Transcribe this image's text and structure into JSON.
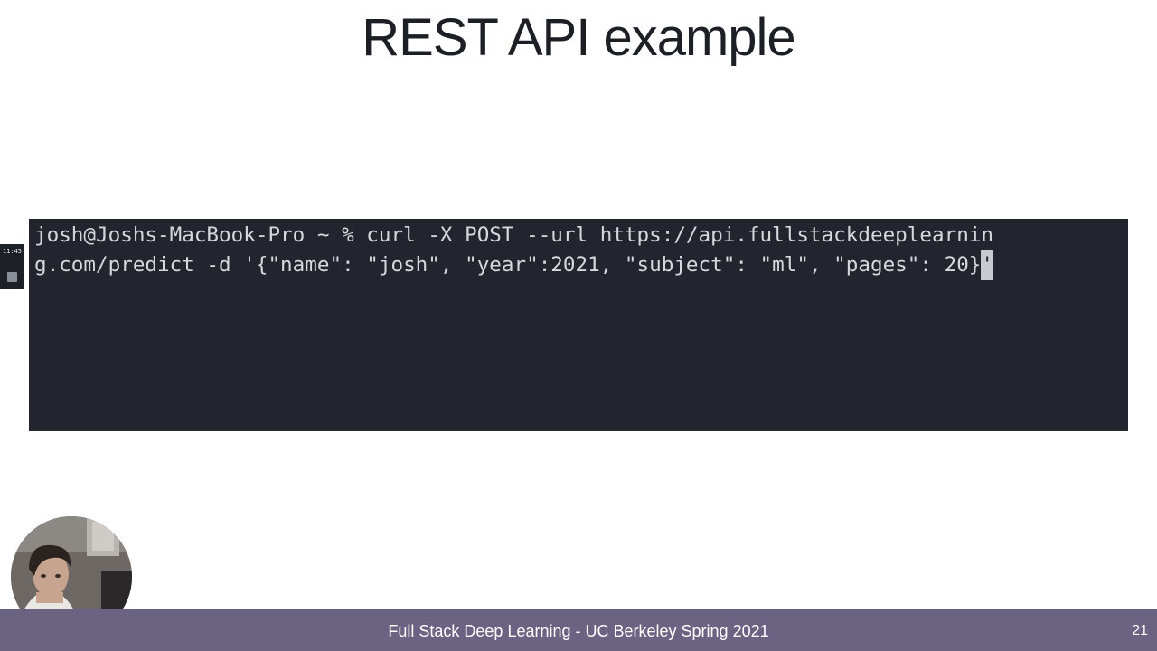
{
  "slide": {
    "title": "REST API example",
    "footer": "Full Stack Deep Learning - UC Berkeley Spring 2021",
    "page_number": "21"
  },
  "terminal": {
    "line1": "josh@Joshs-MacBook-Pro ~ % curl -X POST --url https://api.fullstackdeeplearnin",
    "line2": "g.com/predict -d '{\"name\": \"josh\", \"year\":2021, \"subject\": \"ml\", \"pages\": 20}",
    "cursor_char": "'"
  },
  "recorder": {
    "time": "11:45",
    "stop_icon": "stop-icon"
  },
  "webcam": {
    "icon": "presenter-webcam"
  },
  "colors": {
    "footer_bar": "#6b6382",
    "terminal_bg": "#22252e",
    "terminal_text": "#d6d8dc",
    "title_text": "#1c1f24"
  }
}
